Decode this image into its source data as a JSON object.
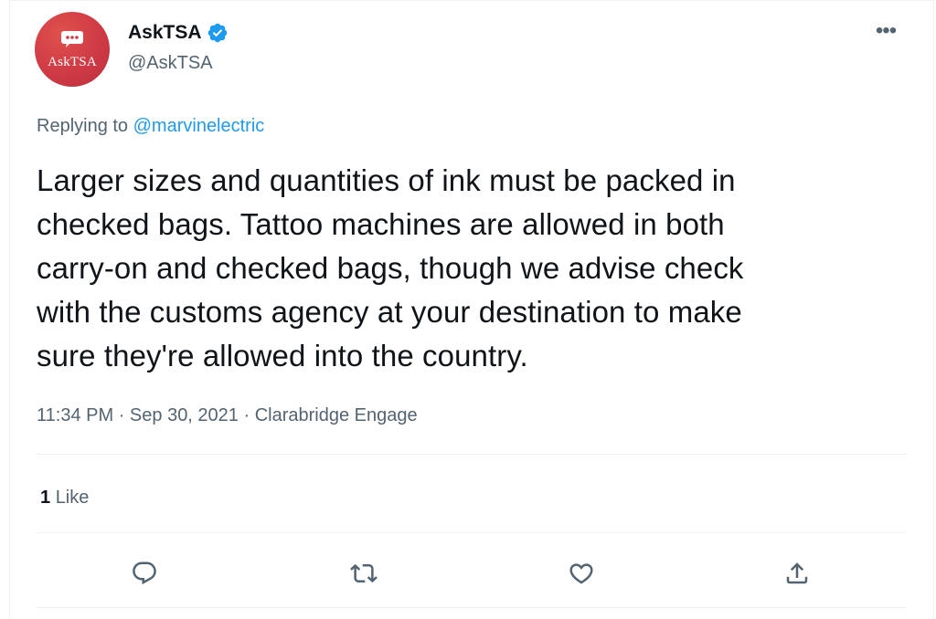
{
  "author": {
    "avatar_text": "AskTSA",
    "display_name": "AskTSA",
    "handle": "@AskTSA",
    "verified": true,
    "avatar_color": "#cf3a45"
  },
  "more_label": "•••",
  "reply": {
    "prefix": "Replying to",
    "mention": "@marvinelectric"
  },
  "tweet": {
    "text": "Larger sizes and quantities of ink must be packed in\nchecked bags. Tattoo machines are allowed in both\ncarry-on and checked bags, though we advise check\nwith the customs agency at your destination to make\nsure they're allowed into the country."
  },
  "meta": {
    "time": "11:34 PM",
    "separator": "·",
    "date": "Sep 30, 2021",
    "source": "Clarabridge Engage"
  },
  "stats": {
    "likes_count": "1",
    "likes_label": "Like"
  },
  "actions": [
    {
      "icon": "reply-icon"
    },
    {
      "icon": "retweet-icon"
    },
    {
      "icon": "like-icon"
    },
    {
      "icon": "share-icon"
    }
  ],
  "colors": {
    "link": "#1d9bf0",
    "verified": "#1d9bf0",
    "secondary_text": "#536471",
    "primary_text": "#0f1419"
  }
}
